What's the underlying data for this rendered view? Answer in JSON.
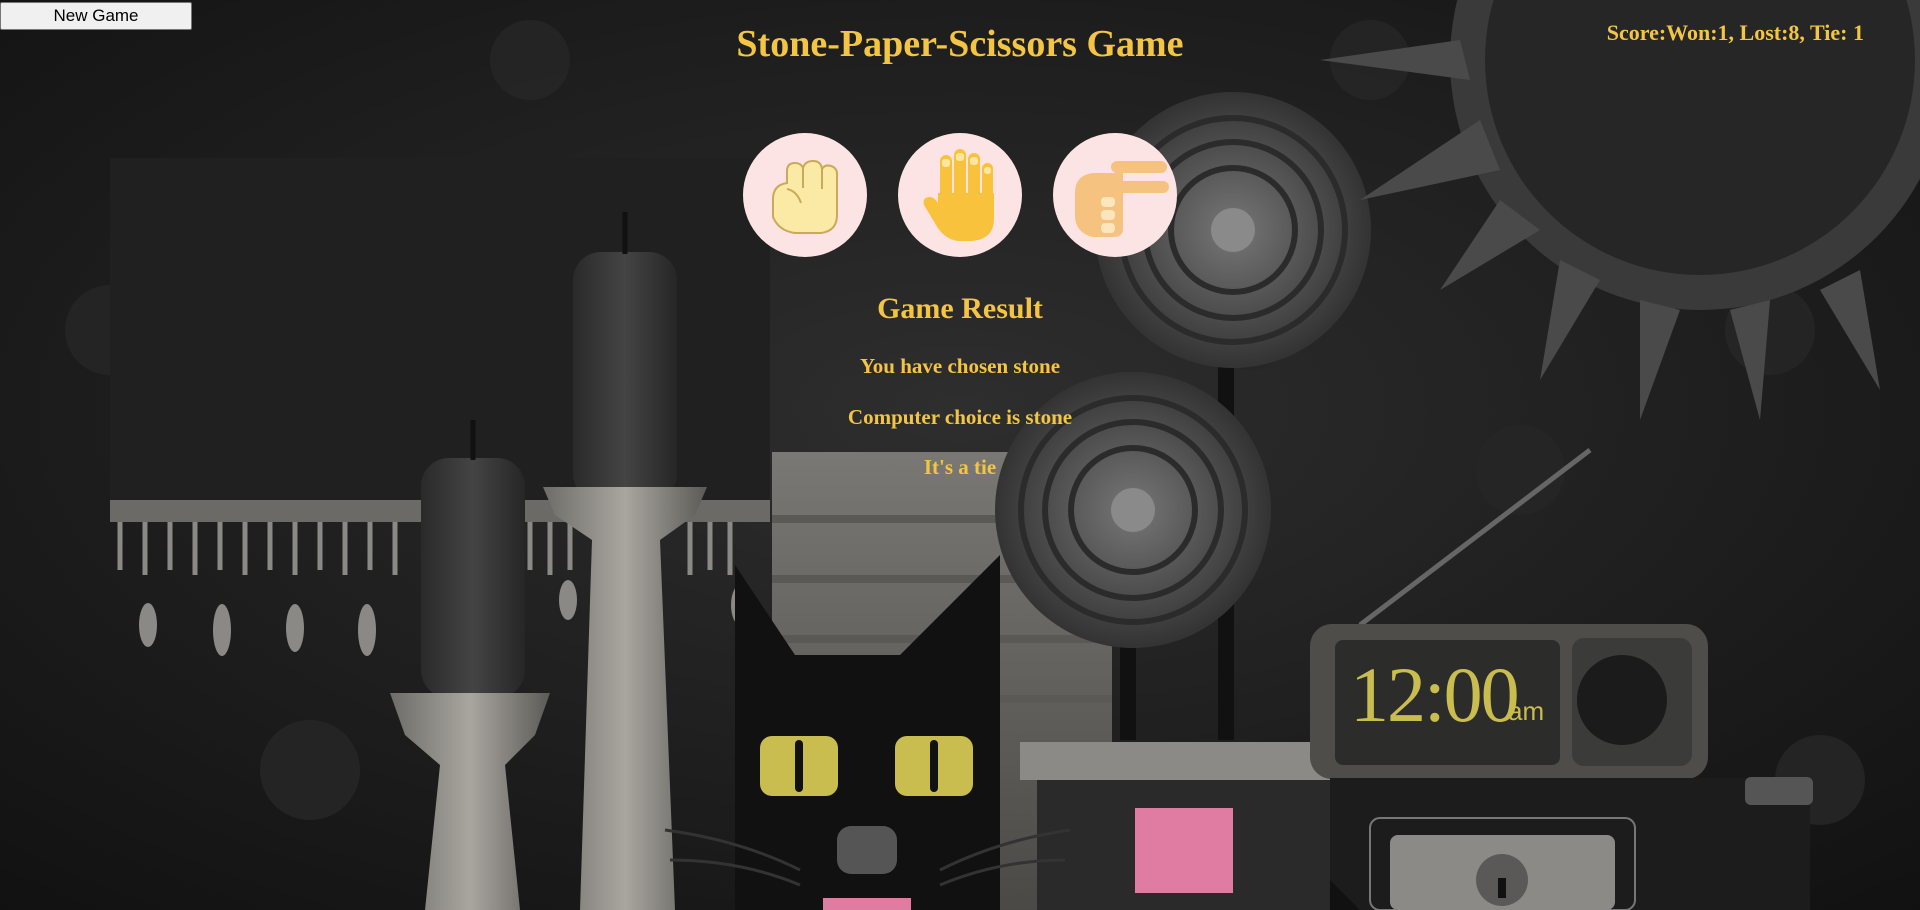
{
  "header": {
    "new_game_label": "New Game",
    "title": "Stone-Paper-Scissors Game",
    "score": "Score:Won:1, Lost:8, Tie: 1"
  },
  "choices": [
    {
      "name": "stone",
      "icon": "fist-icon"
    },
    {
      "name": "paper",
      "icon": "open-hand-icon"
    },
    {
      "name": "scissors",
      "icon": "scissors-hand-icon"
    }
  ],
  "result": {
    "heading": "Game Result",
    "user_choice": "You have chosen stone",
    "computer_choice": "Computer choice is stone",
    "outcome": "It's a tie"
  },
  "clock": {
    "time": "12:00",
    "meridiem": "am"
  },
  "colors": {
    "accent": "#f4c542",
    "choice_bg": "#fce4e4",
    "background": "#1c1c1c"
  }
}
